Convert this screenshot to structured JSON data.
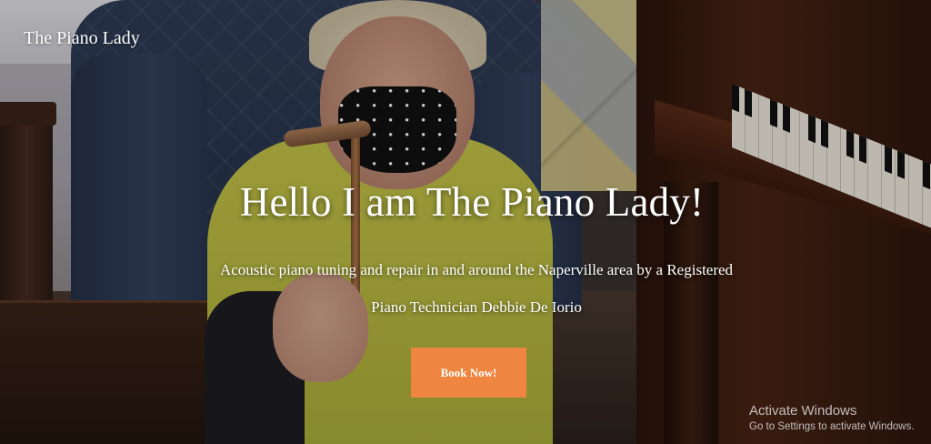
{
  "header": {
    "site_title": "The Piano Lady"
  },
  "hero": {
    "title": "Hello I am The Piano Lady!",
    "subtitle_line1": "Acoustic piano tuning and repair in and around the Naperville area by a Registered",
    "subtitle_line2": "Piano Technician Debbie De Iorio",
    "cta_label": "Book Now!",
    "cta_color": "#ee8540"
  },
  "watermark": {
    "title": "Activate Windows",
    "subtitle": "Go to Settings to activate Windows."
  }
}
